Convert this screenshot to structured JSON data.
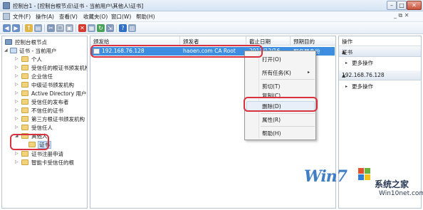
{
  "window": {
    "title": "控制台1 - [控制台根节点\\证书 - 当前用户\\其他人\\证书]",
    "controls": {
      "minimize": "–",
      "maximize": "□",
      "close": "✕"
    }
  },
  "menubar": {
    "items": [
      "文件(F)",
      "操作(A)",
      "查看(V)",
      "收藏夹(O)",
      "窗口(W)",
      "帮助(H)"
    ],
    "right_controls": "_ ⧉ ✕"
  },
  "tree": {
    "items": [
      {
        "label": "控制台根节点"
      },
      {
        "label": "证书 - 当前用户"
      },
      {
        "label": "个人"
      },
      {
        "label": "受信任的根证书颁发机构"
      },
      {
        "label": "企业信任"
      },
      {
        "label": "中级证书颁发机构"
      },
      {
        "label": "Active Directory 用户对象"
      },
      {
        "label": "受信任的发布者"
      },
      {
        "label": "不信任的证书"
      },
      {
        "label": "第三方根证书颁发机构"
      },
      {
        "label": "受信任人"
      },
      {
        "label": "其他人"
      },
      {
        "label": "证书"
      },
      {
        "label": "证书注册申请"
      },
      {
        "label": "智能卡受信任的根"
      }
    ]
  },
  "list": {
    "columns": [
      "颁发给",
      "颁发者",
      "截止日期",
      "预期目的"
    ],
    "rows": [
      {
        "issued_to": "192.168.76.128",
        "issued_by": "haoen.com CA Root",
        "expiry": "2013/12/16",
        "purpose": "服务器身份"
      }
    ]
  },
  "actions": {
    "sections": [
      {
        "title": "证书",
        "items": [
          "更多操作"
        ]
      },
      {
        "title": "192.168.76.128",
        "items": [
          "更多操作"
        ]
      }
    ]
  },
  "context_menu": {
    "items": [
      "打开(O)",
      "所有任务(K)",
      "剪切(T)",
      "复制(C)",
      "删除(D)",
      "属性(R)",
      "帮助(H)"
    ],
    "submenu_arrow": "▸"
  },
  "watermark": {
    "brand": "Win7",
    "site_name": "系统之家",
    "url": "Win10net.com"
  }
}
